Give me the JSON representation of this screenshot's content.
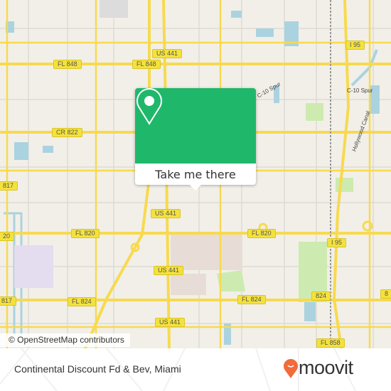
{
  "map": {
    "shields": [
      {
        "label": "US 441",
        "pos": "top-center"
      },
      {
        "label": "FL 848",
        "pos": "left"
      },
      {
        "label": "FL 848",
        "pos": "center"
      },
      {
        "label": "I 95",
        "pos": "top-right"
      },
      {
        "label": "CR 822",
        "pos": "left"
      },
      {
        "label": "817",
        "pos": "left-edge"
      },
      {
        "label": "US 441",
        "pos": "center"
      },
      {
        "label": "20",
        "pos": "left-edge"
      },
      {
        "label": "FL 820",
        "pos": "left"
      },
      {
        "label": "FL 820",
        "pos": "center"
      },
      {
        "label": "I 95",
        "pos": "right"
      },
      {
        "label": "US 441",
        "pos": "lower"
      },
      {
        "label": "817",
        "pos": "left-edge-lower"
      },
      {
        "label": "FL 824",
        "pos": "left"
      },
      {
        "label": "FL 824",
        "pos": "center"
      },
      {
        "label": "824",
        "pos": "right"
      },
      {
        "label": "8",
        "pos": "right-edge"
      },
      {
        "label": "US 441",
        "pos": "bottom"
      },
      {
        "label": "FL 858",
        "pos": "bottom-right"
      }
    ],
    "canals": [
      "C-10 Spur",
      "C-10 Spur",
      "Hollywood Canal"
    ],
    "attribution": "© OpenStreetMap contributors",
    "colors": {
      "land": "#f2efe9",
      "road": "#f7da4f",
      "water": "#aad3df",
      "park": "#cdebb0",
      "popup": "#1fb86a"
    }
  },
  "popup": {
    "icon": "map-pin-icon",
    "button_label": "Take me there"
  },
  "footer": {
    "place": "Continental Discount Fd & Bev, Miami",
    "brand": "moovit",
    "brand_color": "#f26b3a"
  }
}
